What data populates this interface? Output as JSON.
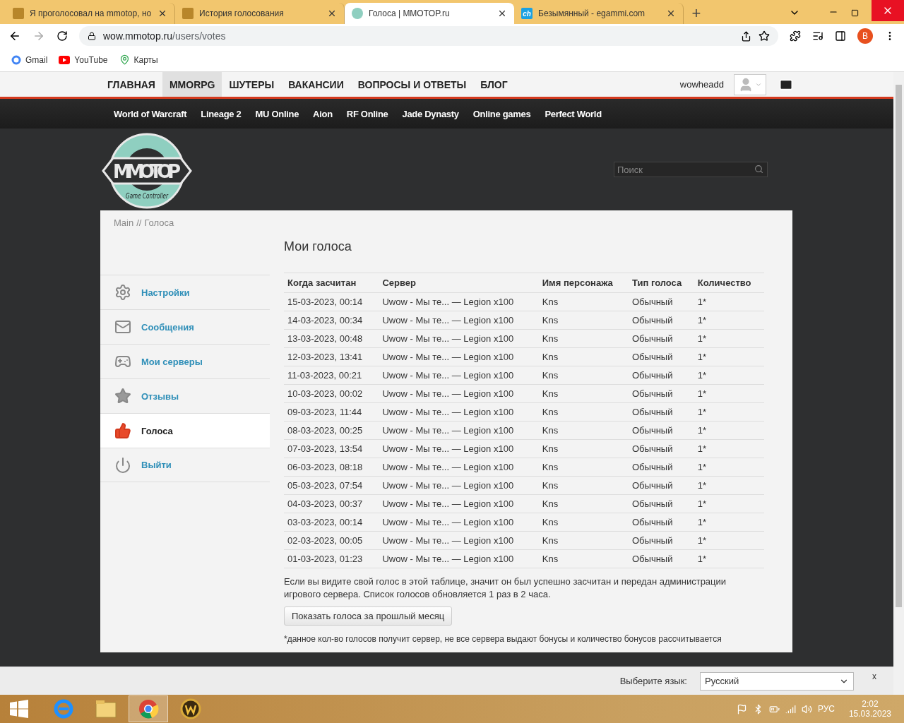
{
  "browser": {
    "tabs": [
      {
        "title": "Я проголосовал на mmotop, но",
        "selected": false,
        "kind": "wow"
      },
      {
        "title": "История голосования",
        "selected": false,
        "kind": "wow"
      },
      {
        "title": "Голоса | MMOTOP.ru",
        "selected": true,
        "kind": "mmotop"
      },
      {
        "title": "Безымянный - egammi.com",
        "selected": false,
        "kind": "ch"
      }
    ],
    "favicon_text": "ch",
    "new_tab": "+",
    "address_host": "wow.mmotop.ru",
    "address_path": "/users/votes",
    "profile": "B",
    "bookmarks": [
      {
        "label": "Gmail",
        "kind": "google"
      },
      {
        "label": "YouTube",
        "kind": "youtube"
      },
      {
        "label": "Карты",
        "kind": "maps"
      }
    ]
  },
  "site": {
    "top_nav": [
      {
        "label": "ГЛАВНАЯ",
        "selected": false
      },
      {
        "label": "MMORPG",
        "selected": true
      },
      {
        "label": "ШУТЕРЫ",
        "selected": false
      },
      {
        "label": "ВАКАНСИИ",
        "selected": false
      },
      {
        "label": "ВОПРОСЫ И ОТВЕТЫ",
        "selected": false
      },
      {
        "label": "БЛОГ",
        "selected": false
      }
    ],
    "username": "wowheadd",
    "game_nav": [
      "World of Warcraft",
      "Lineage 2",
      "MU Online",
      "Aion",
      "RF Online",
      "Jade Dynasty",
      "Online games",
      "Perfect World"
    ],
    "logo": {
      "title": "MMOTOP",
      "subtitle": "Game Controller"
    },
    "search": {
      "placeholder": "Поиск"
    },
    "breadcrumb": {
      "home": "Main",
      "separator": "//",
      "current": "Голоса"
    },
    "page_title": "Мои голоса",
    "sidebar": [
      {
        "label": "Настройки",
        "kind": "settings",
        "selected": false
      },
      {
        "label": "Сообщения",
        "kind": "mail",
        "selected": false
      },
      {
        "label": "Мои серверы",
        "kind": "gamepad",
        "selected": false
      },
      {
        "label": "Отзывы",
        "kind": "star",
        "selected": false
      },
      {
        "label": "Голоса",
        "kind": "vote",
        "selected": true
      },
      {
        "label": "Выйти",
        "kind": "logout",
        "selected": false
      }
    ],
    "table": {
      "columns": [
        "Когда засчитан",
        "Сервер",
        "Имя персонажа",
        "Тип голоса",
        "Количество"
      ],
      "rows": [
        [
          "15-03-2023, 00:14",
          "Uwow - Мы те... — Legion x100",
          "Kns",
          "Обычный",
          "1*"
        ],
        [
          "14-03-2023, 00:34",
          "Uwow - Мы те... — Legion x100",
          "Kns",
          "Обычный",
          "1*"
        ],
        [
          "13-03-2023, 00:48",
          "Uwow - Мы те... — Legion x100",
          "Kns",
          "Обычный",
          "1*"
        ],
        [
          "12-03-2023, 13:41",
          "Uwow - Мы те... — Legion x100",
          "Kns",
          "Обычный",
          "1*"
        ],
        [
          "11-03-2023, 00:21",
          "Uwow - Мы те... — Legion x100",
          "Kns",
          "Обычный",
          "1*"
        ],
        [
          "10-03-2023, 00:02",
          "Uwow - Мы те... — Legion x100",
          "Kns",
          "Обычный",
          "1*"
        ],
        [
          "09-03-2023, 11:44",
          "Uwow - Мы те... — Legion x100",
          "Kns",
          "Обычный",
          "1*"
        ],
        [
          "08-03-2023, 00:25",
          "Uwow - Мы те... — Legion x100",
          "Kns",
          "Обычный",
          "1*"
        ],
        [
          "07-03-2023, 13:54",
          "Uwow - Мы те... — Legion x100",
          "Kns",
          "Обычный",
          "1*"
        ],
        [
          "06-03-2023, 08:18",
          "Uwow - Мы те... — Legion x100",
          "Kns",
          "Обычный",
          "1*"
        ],
        [
          "05-03-2023, 07:54",
          "Uwow - Мы те... — Legion x100",
          "Kns",
          "Обычный",
          "1*"
        ],
        [
          "04-03-2023, 00:37",
          "Uwow - Мы те... — Legion x100",
          "Kns",
          "Обычный",
          "1*"
        ],
        [
          "03-03-2023, 00:14",
          "Uwow - Мы те... — Legion x100",
          "Kns",
          "Обычный",
          "1*"
        ],
        [
          "02-03-2023, 00:05",
          "Uwow - Мы те... — Legion x100",
          "Kns",
          "Обычный",
          "1*"
        ],
        [
          "01-03-2023, 01:23",
          "Uwow - Мы те... — Legion x100",
          "Kns",
          "Обычный",
          "1*"
        ]
      ]
    },
    "note": "Если вы видите свой голос в этой таблице, значит он был успешно засчитан и передан администрации игрового сервера. Список голосов обновляется 1 раз в 2 часа.",
    "button": "Показать голоса за прошлый месяц",
    "footnote": "*данное кол-во голосов получит сервер, не все сервера выдают бонусы и количество бонусов рассчитывается"
  },
  "language_bar": {
    "label": "Выберите язык:",
    "value": "Русский",
    "close": "x"
  },
  "taskbar": {
    "apps": [
      {
        "kind": "ie",
        "selected": false
      },
      {
        "kind": "explorer",
        "selected": false
      },
      {
        "kind": "chrome",
        "selected": true
      },
      {
        "kind": "wow",
        "selected": false
      }
    ],
    "language": "РУС",
    "time": "2:02",
    "date": "15.03.2023"
  }
}
